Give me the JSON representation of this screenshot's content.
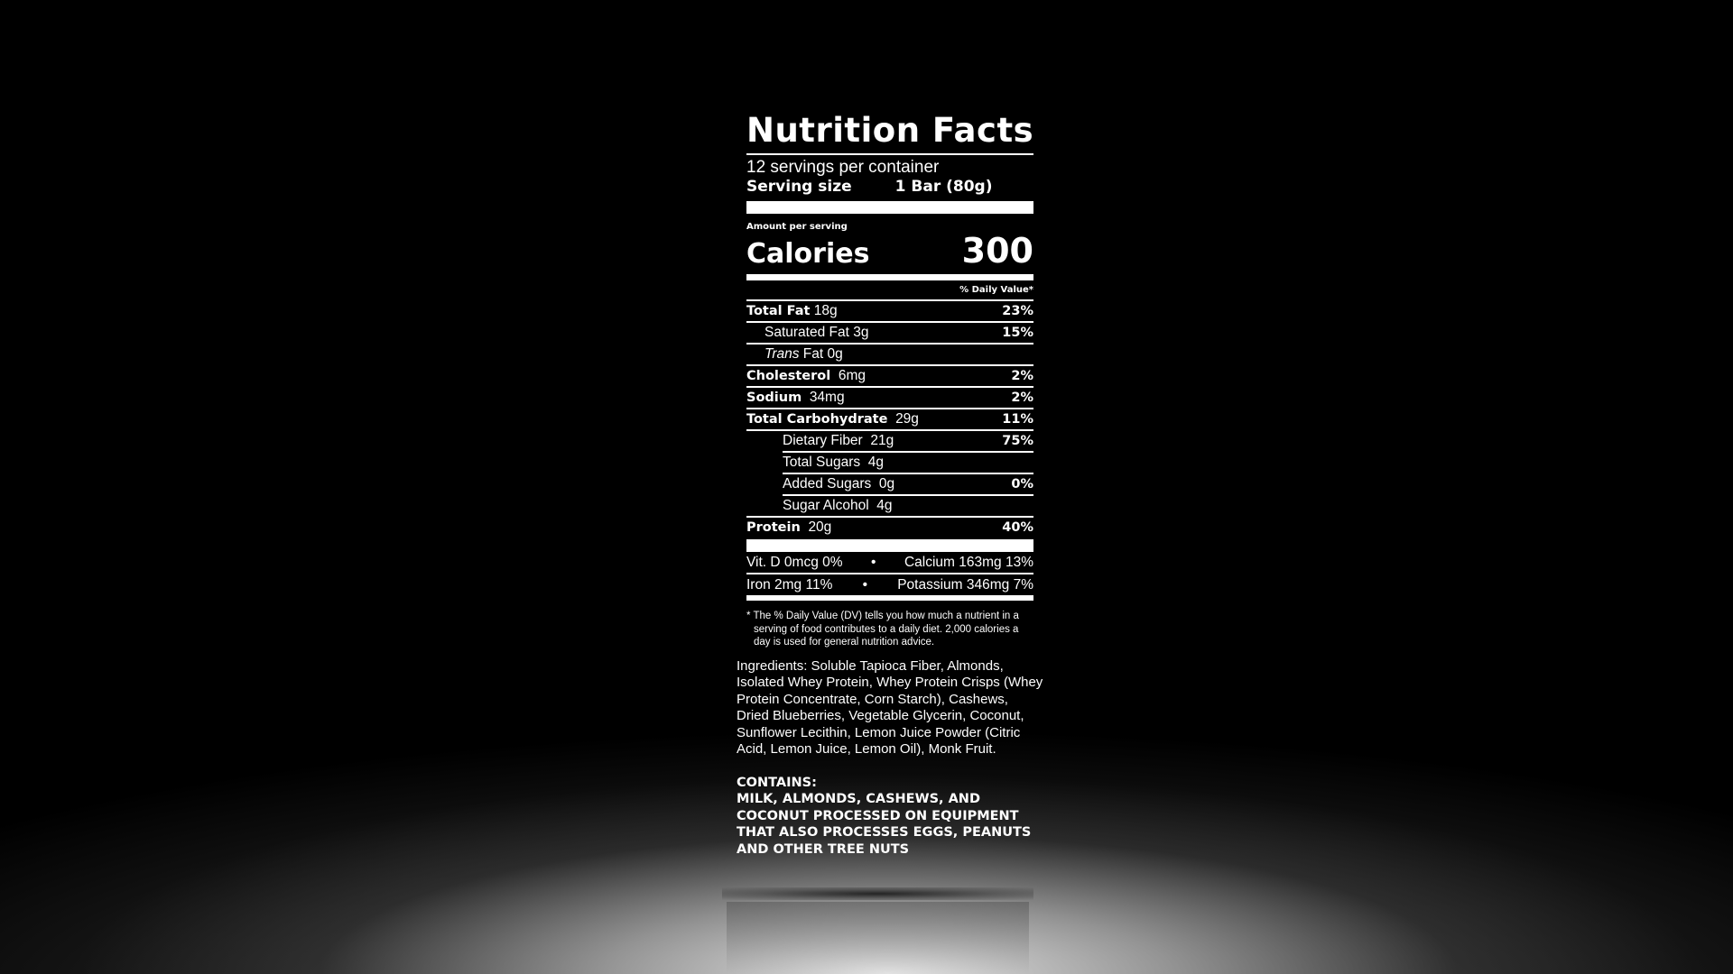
{
  "label": {
    "title": "Nutrition Facts",
    "servings_per_container": "12 servings per container",
    "serving_size_label": "Serving size",
    "serving_size_value": "1 Bar (80g)",
    "amount_per_serving": "Amount per serving",
    "calories_label": "Calories",
    "calories_value": "300",
    "daily_value_header": "% Daily Value*",
    "rows": {
      "total_fat": {
        "name": "Total Fat",
        "amount": "18g",
        "dv": "23%"
      },
      "saturated_fat": {
        "name": "Saturated Fat",
        "amount": "3g",
        "dv": "15%"
      },
      "trans_fat": {
        "name_italic": "Trans",
        "name_rest": "Fat",
        "amount": "0g"
      },
      "cholesterol": {
        "name": "Cholesterol",
        "amount": "6mg",
        "dv": "2%"
      },
      "sodium": {
        "name": "Sodium",
        "amount": "34mg",
        "dv": "2%"
      },
      "total_carbohydrate": {
        "name": "Total Carbohydrate",
        "amount": "29g",
        "dv": "11%"
      },
      "dietary_fiber": {
        "name": "Dietary Fiber",
        "amount": "21g",
        "dv": "75%"
      },
      "total_sugars": {
        "name": "Total Sugars",
        "amount": "4g"
      },
      "added_sugars": {
        "name": "Added Sugars",
        "amount": "0g",
        "dv": "0%"
      },
      "sugar_alcohol": {
        "name": "Sugar Alcohol",
        "amount": "4g"
      },
      "protein": {
        "name": "Protein",
        "amount": "20g",
        "dv": "40%"
      }
    },
    "vitamins": {
      "vit_d": "Vit. D 0mcg 0%",
      "calcium": "Calcium 163mg 13%",
      "iron": "Iron 2mg 11%",
      "potassium": "Potassium 346mg 7%",
      "separator": "•"
    },
    "footnote": "* The % Daily Value (DV) tells you how much a nutrient in a serving of food contributes to a daily diet. 2,000 calories a day is used for general nutrition advice."
  },
  "ingredients": "Ingredients: Soluble Tapioca Fiber, Almonds, Isolated Whey Protein, Whey Protein Crisps (Whey Protein Concentrate, Corn Starch), Cashews, Dried Blueberries, Vegetable Glycerin, Coconut, Sunflower Lecithin, Lemon Juice Powder (Citric Acid, Lemon Juice, Lemon Oil), Monk Fruit.",
  "allergens": {
    "heading": "CONTAINS:",
    "text": "MILK, ALMONDS, CASHEWS, AND COCONUT PROCESSED ON EQUIPMENT THAT ALSO PROCESSES EGGS, PEANUTS AND OTHER TREE NUTS"
  },
  "colors": {
    "background": "#000000",
    "text": "#ffffff",
    "floor_light": "#e6e6e6"
  }
}
